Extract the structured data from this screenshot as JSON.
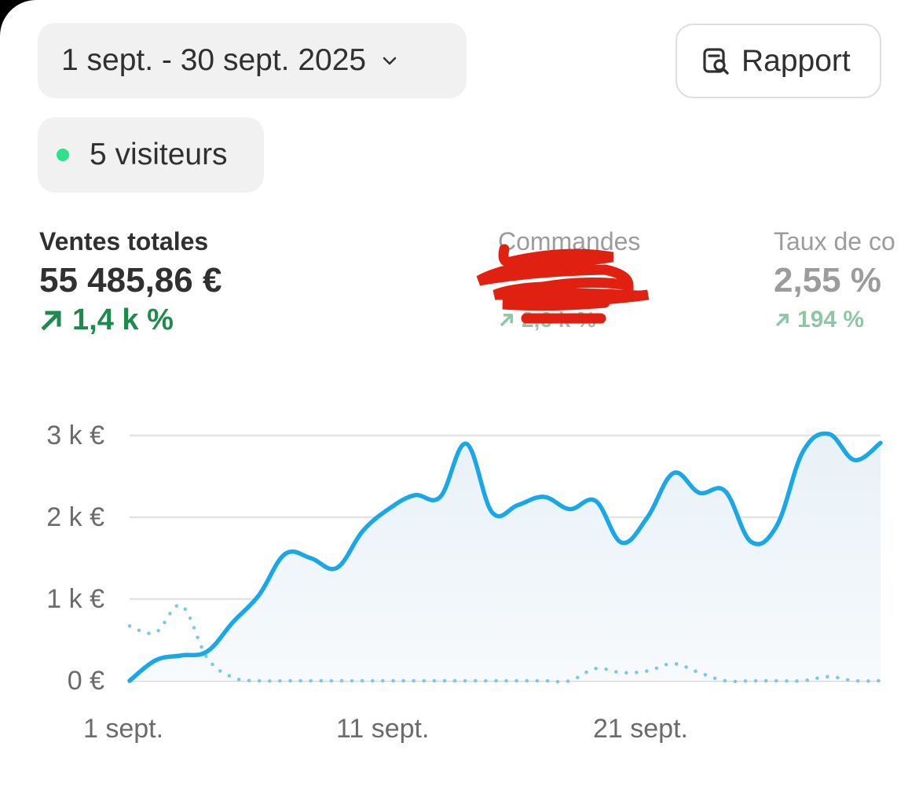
{
  "header": {
    "date_range_label": "1 sept. - 30 sept. 2025",
    "report_label": "Rapport",
    "visitors_label": "5 visiteurs"
  },
  "metrics": [
    {
      "label": "Ventes totales",
      "value": "55 485,86 €",
      "delta": "1,4 k %"
    },
    {
      "label": "Commandes",
      "value": "",
      "delta": "2,6 k %"
    },
    {
      "label": "Taux de co",
      "value": "2,55 %",
      "delta": "194 %"
    }
  ],
  "colors": {
    "accent": "#1aa7e8",
    "comparison": "#7cc8e8",
    "positive": "#1f8a4e",
    "live_dot": "#2ee08a",
    "redaction": "#e02010"
  },
  "chart_data": {
    "type": "line",
    "x_tick_labels": [
      "1 sept.",
      "11 sept.",
      "21 sept."
    ],
    "y_tick_labels": [
      "0 €",
      "1 k €",
      "2 k €",
      "3 k €"
    ],
    "ylim": [
      0,
      3000
    ],
    "grid": true,
    "x_days": [
      1,
      2,
      3,
      4,
      5,
      6,
      7,
      8,
      9,
      10,
      11,
      12,
      13,
      14,
      15,
      16,
      17,
      18,
      19,
      20,
      21,
      22,
      23,
      24,
      25,
      26,
      27,
      28,
      29,
      30
    ],
    "series": [
      {
        "style": "solid",
        "values": [
          0,
          250,
          310,
          360,
          720,
          1050,
          1550,
          1500,
          1380,
          1830,
          2100,
          2270,
          2250,
          2900,
          2060,
          2150,
          2250,
          2100,
          2200,
          1690,
          2000,
          2540,
          2300,
          2320,
          1700,
          1900,
          2800,
          3020,
          2700,
          2910
        ]
      },
      {
        "style": "dotted",
        "values": [
          670,
          590,
          920,
          280,
          40,
          0,
          0,
          0,
          0,
          0,
          0,
          0,
          0,
          0,
          0,
          0,
          0,
          0,
          150,
          100,
          120,
          210,
          100,
          0,
          0,
          0,
          0,
          50,
          0,
          0
        ]
      }
    ]
  }
}
